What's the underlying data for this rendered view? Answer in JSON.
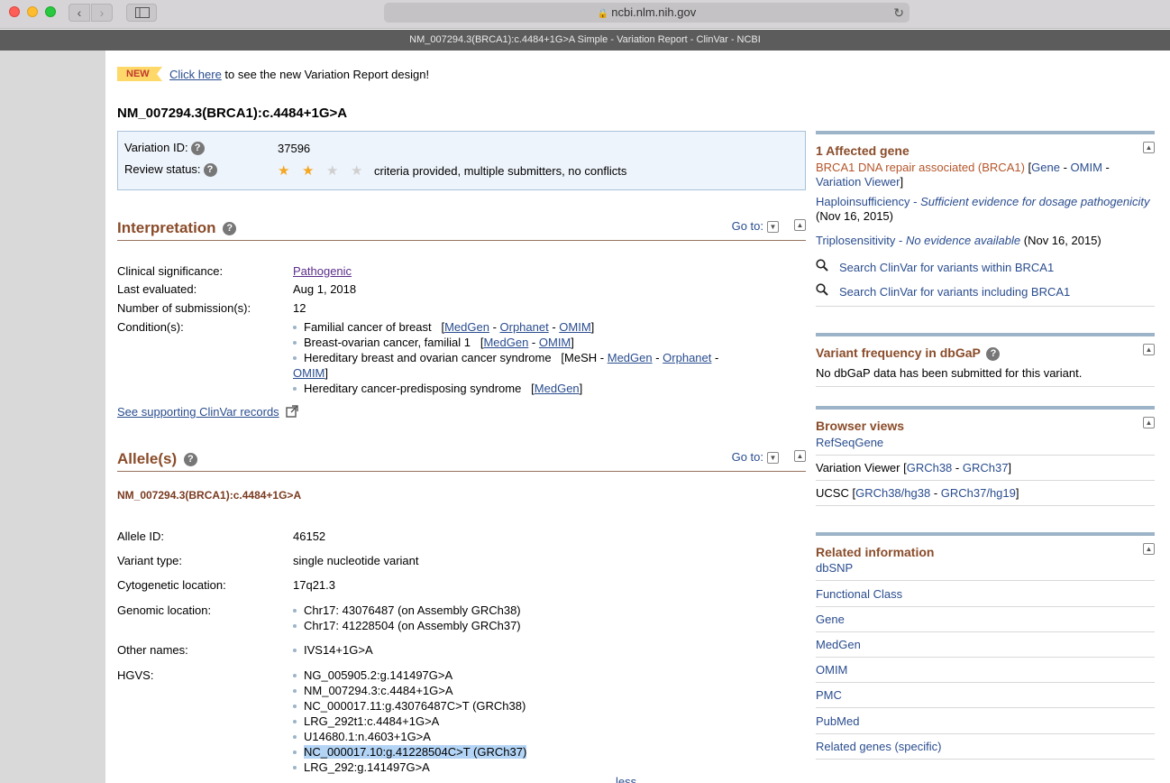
{
  "browser": {
    "url": "ncbi.nlm.nih.gov",
    "tab_title": "NM_007294.3(BRCA1):c.4484+1G>A Simple - Variation Report - ClinVar - NCBI"
  },
  "banner": {
    "badge": "NEW",
    "link": "Click here",
    "text": " to see the new Variation Report design!"
  },
  "title": "NM_007294.3(BRCA1):c.4484+1G>A",
  "summary": {
    "variation_id_label": "Variation ID:",
    "variation_id": "37596",
    "review_status_label": "Review status:",
    "stars_filled": 2,
    "stars_total": 4,
    "review_status": "criteria provided, multiple submitters, no conflicts"
  },
  "interpretation": {
    "heading": "Interpretation",
    "goto": "Go to:",
    "clinical_significance_label": "Clinical significance:",
    "clinical_significance": "Pathogenic",
    "last_evaluated_label": "Last evaluated:",
    "last_evaluated": "Aug 1, 2018",
    "submissions_label": "Number of submission(s):",
    "submissions": "12",
    "conditions_label": "Condition(s):",
    "conditions": [
      {
        "name": "Familial cancer of breast",
        "links": [
          "MedGen",
          "Orphanet",
          "OMIM"
        ]
      },
      {
        "name": "Breast-ovarian cancer, familial 1",
        "links": [
          "MedGen",
          "OMIM"
        ]
      },
      {
        "name": "Hereditary breast and ovarian cancer syndrome",
        "links": [
          "MeSH",
          "MedGen",
          "Orphanet",
          "OMIM"
        ]
      },
      {
        "name": "Hereditary cancer-predisposing syndrome",
        "links": [
          "MedGen"
        ]
      }
    ],
    "see_supporting": "See supporting ClinVar records"
  },
  "alleles": {
    "heading": "Allele(s)",
    "goto": "Go to:",
    "subtitle": "NM_007294.3(BRCA1):c.4484+1G>A",
    "allele_id_label": "Allele ID:",
    "allele_id": "46152",
    "variant_type_label": "Variant type:",
    "variant_type": "single nucleotide variant",
    "cytogenetic_label": "Cytogenetic location:",
    "cytogenetic": "17q21.3",
    "genomic_label": "Genomic location:",
    "genomic": [
      "Chr17: 43076487 (on Assembly GRCh38)",
      "Chr17: 41228504 (on Assembly GRCh37)"
    ],
    "other_names_label": "Other names:",
    "other_names": [
      "IVS14+1G>A"
    ],
    "hgvs_label": "HGVS:",
    "hgvs": [
      "NG_005905.2:g.141497G>A",
      "NM_007294.3:c.4484+1G>A",
      "NC_000017.11:g.43076487C>T (GRCh38)",
      "LRG_292t1:c.4484+1G>A",
      "U14680.1:n.4603+1G>A",
      "NC_000017.10:g.41228504C>T (GRCh37)",
      "LRG_292:g.141497G>A"
    ],
    "less": "less"
  },
  "affected_gene": {
    "heading": "1 Affected gene",
    "gene": "BRCA1 DNA repair associated (BRCA1)",
    "gene_links": [
      "Gene",
      "OMIM",
      "Variation Viewer"
    ],
    "haplo_label": "Haploinsufficiency - ",
    "haplo_value": "Sufficient evidence for dosage pathogenicity",
    "haplo_date": "(Nov 16, 2015)",
    "triplo_label": "Triplosensitivity - ",
    "triplo_value": "No evidence available",
    "triplo_date": " (Nov 16, 2015)",
    "search1": "Search ClinVar for variants within BRCA1",
    "search2": "Search ClinVar for variants including BRCA1"
  },
  "variant_freq": {
    "heading": "Variant frequency in dbGaP",
    "text": "No dbGaP data has been submitted for this variant."
  },
  "browser_views": {
    "heading": "Browser views",
    "refseqgene": "RefSeqGene",
    "vv_label": "Variation Viewer",
    "vv_links": [
      "GRCh38",
      "GRCh37"
    ],
    "ucsc_label": "UCSC",
    "ucsc_links": [
      "GRCh38/hg38",
      "GRCh37/hg19"
    ]
  },
  "related": {
    "heading": "Related information",
    "items": [
      "dbSNP",
      "Functional Class",
      "Gene",
      "MedGen",
      "OMIM",
      "PMC",
      "PubMed",
      "Related genes (specific)"
    ]
  }
}
